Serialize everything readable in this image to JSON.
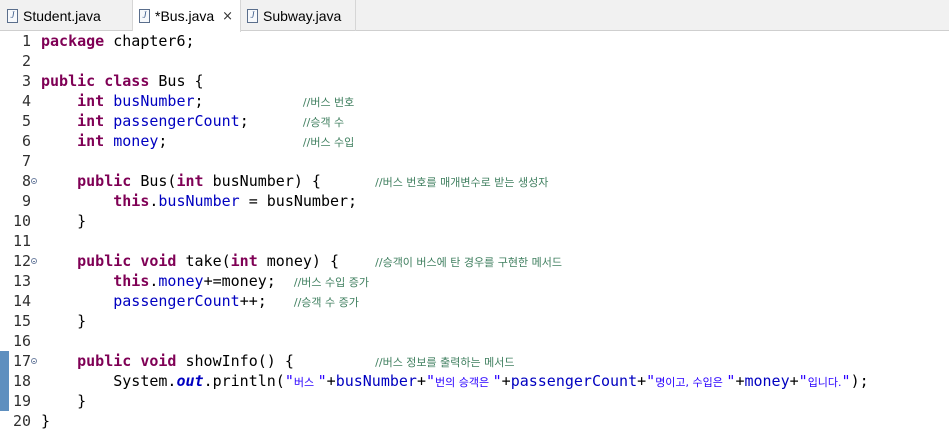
{
  "tabs": [
    {
      "label": "Student.java",
      "active": false,
      "closable": false
    },
    {
      "label": "*Bus.java",
      "active": true,
      "closable": true
    },
    {
      "label": "Subway.java",
      "active": false,
      "closable": false
    }
  ],
  "tab_close_glyph": "×",
  "file_icon_glyph": "J",
  "line_numbers": [
    "1",
    "2",
    "3",
    "4",
    "5",
    "6",
    "7",
    "8",
    "9",
    "10",
    "11",
    "12",
    "13",
    "14",
    "15",
    "16",
    "17",
    "18",
    "19",
    "20"
  ],
  "code": {
    "l1": {
      "kw": "package",
      "rest": " chapter6;"
    },
    "l3": {
      "kw1": "public",
      "kw2": "class",
      "rest": " Bus {"
    },
    "l4": {
      "indent": "    ",
      "kw": "int",
      "fld": "busNumber",
      "rest": ";           ",
      "cmt": "//버스 번호"
    },
    "l5": {
      "indent": "    ",
      "kw": "int",
      "fld": "passengerCount",
      "rest": ";      ",
      "cmt": "//승객 수"
    },
    "l6": {
      "indent": "    ",
      "kw": "int",
      "fld": "money",
      "rest": ";               ",
      "cmt": "//버스 수입"
    },
    "l8": {
      "indent": "    ",
      "kw1": "public",
      "a": " Bus(",
      "kw2": "int",
      "b": " busNumber) {      ",
      "cmt": "//버스 번호를 매개변수로 받는 생성자"
    },
    "l9": {
      "indent": "        ",
      "kw": "this",
      "dot": ".",
      "fld": "busNumber",
      "rest": " = busNumber;"
    },
    "l10": {
      "text": "    }"
    },
    "l12": {
      "indent": "    ",
      "kw1": "public",
      "kw2": "void",
      "a": " take(",
      "kw3": "int",
      "b": " money) {    ",
      "cmt": "//승객이 버스에 탄 경우를 구현한 메서드"
    },
    "l13": {
      "indent": "        ",
      "kw": "this",
      "dot": ".",
      "fld": "money",
      "rest": "+=money;  ",
      "cmt": "//버스 수입 증가"
    },
    "l14": {
      "indent": "        ",
      "fld": "passengerCount",
      "rest": "++;   ",
      "cmt": "//승객 수 증가"
    },
    "l15": {
      "text": "    }"
    },
    "l17": {
      "indent": "    ",
      "kw1": "public",
      "kw2": "void",
      "a": " showInfo() {         ",
      "cmt": "//버스 정보를 출력하는 메서드"
    },
    "l18": {
      "indent": "        ",
      "a": "System.",
      "stat": "out",
      "b": ".println(",
      "s1q": "\"",
      "s1k": "버스 ",
      "s1e": "\"",
      "c": "+",
      "f1": "busNumber",
      "d": "+",
      "s2q": "\"",
      "s2k": "번의 승객은 ",
      "s2e": "\"",
      "e": "+",
      "f2": "passengerCount",
      "f": "+",
      "s3q": "\"",
      "s3k": "명이고, 수입은 ",
      "s3e": "\"",
      "g": "+",
      "f3": "money",
      "h": "+",
      "s4q": "\"",
      "s4k": "입니다.",
      "s4e": "\"",
      "i": ");"
    },
    "l19": {
      "text": "    }"
    },
    "l20": {
      "text": "}"
    }
  },
  "colors": {
    "keyword": "#7f0055",
    "field": "#0000c0",
    "comment": "#3f7f5f",
    "string": "#2a00ff",
    "change_marker": "#5e8fbf"
  },
  "fold_lines": [
    8,
    12,
    17
  ],
  "changed_lines": [
    17,
    18,
    19
  ]
}
